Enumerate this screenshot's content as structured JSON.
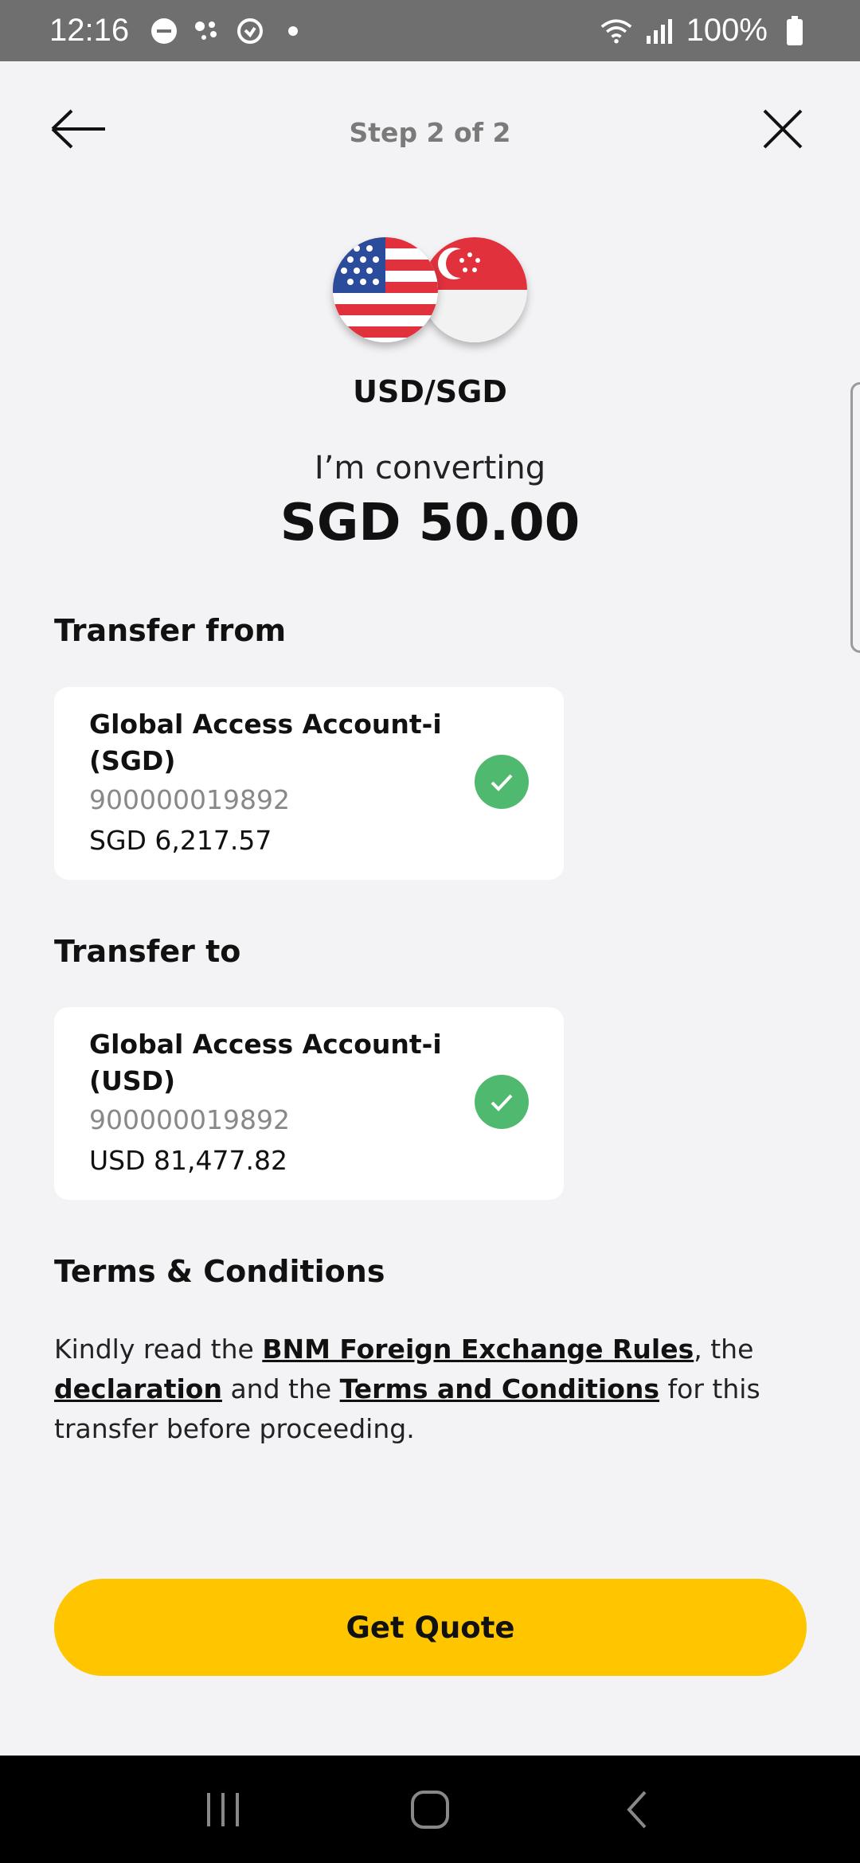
{
  "status_bar": {
    "time": "12:16",
    "battery": "100%",
    "icons": [
      "dnd-icon",
      "assistant-icon",
      "sync-icon",
      "dot-icon",
      "wifi-icon",
      "signal-icon",
      "battery-icon"
    ]
  },
  "header": {
    "step": "Step 2 of 2"
  },
  "currency": {
    "pair": "USD/SGD"
  },
  "conversion": {
    "label": "I’m converting",
    "amount": "SGD 50.00"
  },
  "transfer_from": {
    "title": "Transfer from",
    "account_name": "Global Access Account-i (SGD)",
    "account_number": "900000019892",
    "balance": "SGD 6,217.57"
  },
  "transfer_to": {
    "title": "Transfer to",
    "account_name": "Global Access Account-i (USD)",
    "account_number": "900000019892",
    "balance": "USD 81,477.82"
  },
  "terms": {
    "title": "Terms & Conditions",
    "text_1": "Kindly read the ",
    "link_1": "BNM Foreign Exchange Rules",
    "text_2": ", the ",
    "link_2": "declaration",
    "text_3": " and the ",
    "link_3": "Terms and Conditions",
    "text_4": " for this transfer before proceeding."
  },
  "actions": {
    "get_quote": "Get Quote"
  },
  "colors": {
    "accent": "#ffc600",
    "check": "#4fba6f"
  }
}
